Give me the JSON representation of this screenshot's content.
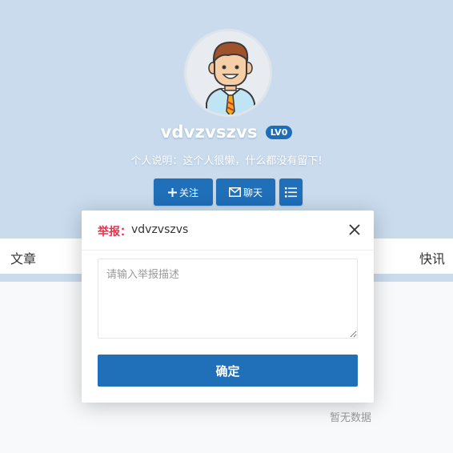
{
  "profile": {
    "username": "vdvzvszvs",
    "level": "LV0",
    "bio": "个人说明：这个人很懒，什么都没有留下!",
    "follow_label": "关注",
    "chat_label": "聊天"
  },
  "tabs": {
    "articles": "文章",
    "news": "快讯"
  },
  "empty": {
    "text": "暂无数据"
  },
  "report_modal": {
    "title_prefix": "举报：",
    "title_name": "vdvzvszvs",
    "placeholder": "请输入举报描述",
    "confirm_label": "确定"
  },
  "colors": {
    "profile_bg": "#c9dbed",
    "primary": "#1f6fb9",
    "report_red": "#e8304d"
  }
}
